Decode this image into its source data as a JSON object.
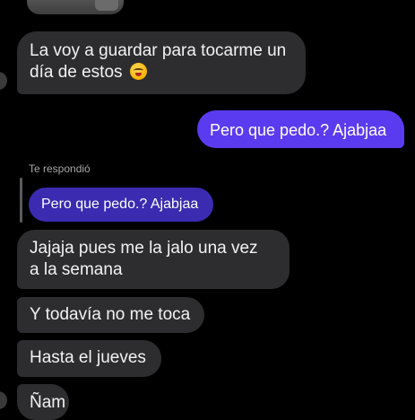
{
  "messages": {
    "m1": {
      "line1": "La voy a guardar para tocarme un",
      "line2": "día de estos",
      "emoji": "yum-face-emoji"
    },
    "m2": {
      "text": "Pero que pedo.? Ajabjaa"
    },
    "reply": {
      "label": "Te respondió",
      "quoted_text": "Pero que pedo.? Ajabjaa"
    },
    "m3": {
      "line1": "Jajaja pues me la jalo una vez",
      "line2": "a la semana"
    },
    "m4": {
      "text": "Y todavía no me toca"
    },
    "m5": {
      "text": "Hasta el jueves"
    },
    "m6": {
      "text": "Ñam"
    }
  },
  "colors": {
    "background": "#000000",
    "incoming_bubble": "#2d2d30",
    "outgoing_bubble": "#5b3bf0",
    "quoted_bubble": "#3a2bb0",
    "meta_text": "#a8a8a8"
  }
}
